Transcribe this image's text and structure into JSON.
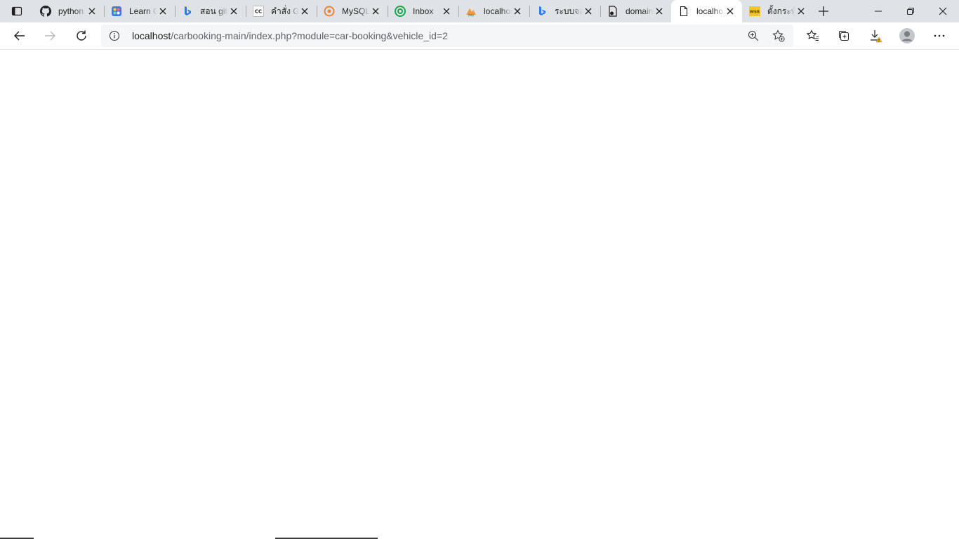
{
  "browser": {
    "tabs": [
      {
        "title": "python",
        "icon": "github-icon",
        "active": false
      },
      {
        "title": "Learn Git",
        "icon": "learn-icon",
        "active": false
      },
      {
        "title": "สอน git",
        "icon": "bing-icon",
        "active": false
      },
      {
        "title": "คำสั่ง Git",
        "icon": "cc-icon",
        "active": false
      },
      {
        "title": "MySQL",
        "icon": "mysql-icon",
        "active": false
      },
      {
        "title": "Inbox",
        "icon": "inbox-icon",
        "active": false
      },
      {
        "title": "localhost",
        "icon": "phpmyadmin-icon",
        "active": false
      },
      {
        "title": "ระบบจอง",
        "icon": "bing-icon",
        "active": false
      },
      {
        "title": "domain",
        "icon": "document-icon",
        "active": false
      },
      {
        "title": "localhost",
        "icon": "page-icon",
        "active": true
      },
      {
        "title": "ตั้งกระทู้",
        "icon": "wsr-icon",
        "active": false
      }
    ],
    "address": {
      "host": "localhost",
      "path": "/carbooking-main/index.php?module=car-booking&vehicle_id=2"
    },
    "colors": {
      "tabstrip": "#dfe3e7",
      "active_tab": "#ffffff",
      "omnibox": "#f5f6f7",
      "warning": "#f2b600"
    }
  }
}
